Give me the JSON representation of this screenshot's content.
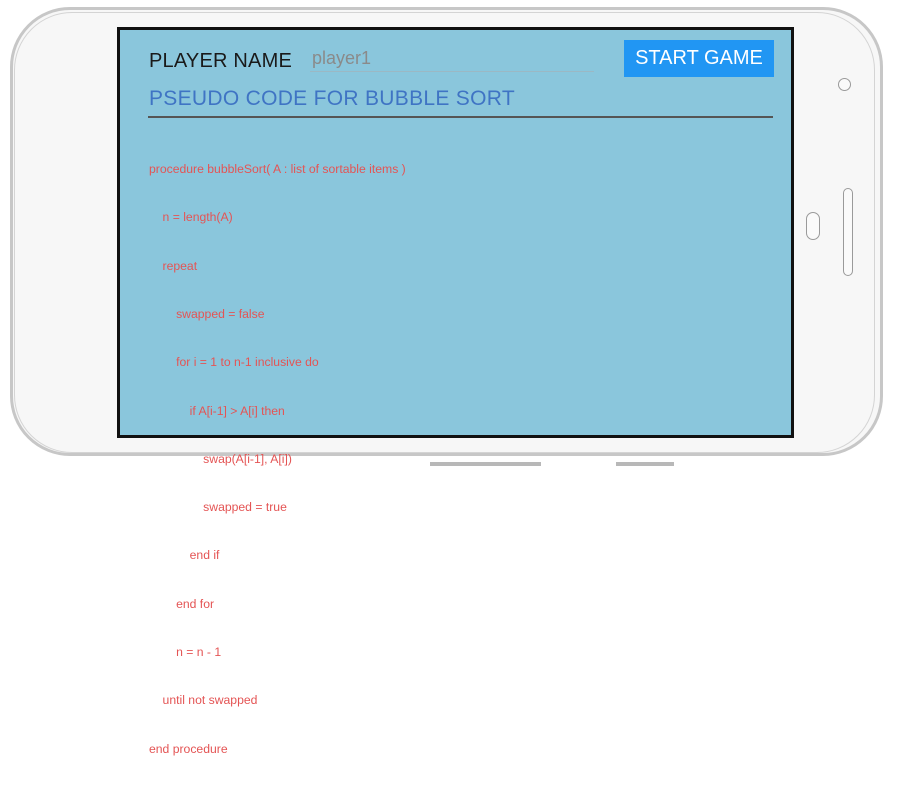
{
  "header": {
    "player_label": "PLAYER NAME",
    "player_input_value": "player1",
    "start_button_label": "START GAME"
  },
  "section": {
    "title": "PSEUDO CODE FOR BUBBLE SORT"
  },
  "code": {
    "lines": [
      "procedure bubbleSort( A : list of sortable items )",
      "    n = length(A)",
      "    repeat",
      "        swapped = false",
      "        for i = 1 to n-1 inclusive do",
      "            if A[i-1] > A[i] then",
      "                swap(A[i-1], A[i])",
      "                swapped = true",
      "            end if",
      "        end for",
      "        n = n - 1",
      "    until not swapped",
      "end procedure"
    ]
  },
  "colors": {
    "screen_background": "#8ac6dc",
    "button_background": "#2196f3",
    "title_color": "#3f74c4",
    "code_color": "#e45454"
  }
}
